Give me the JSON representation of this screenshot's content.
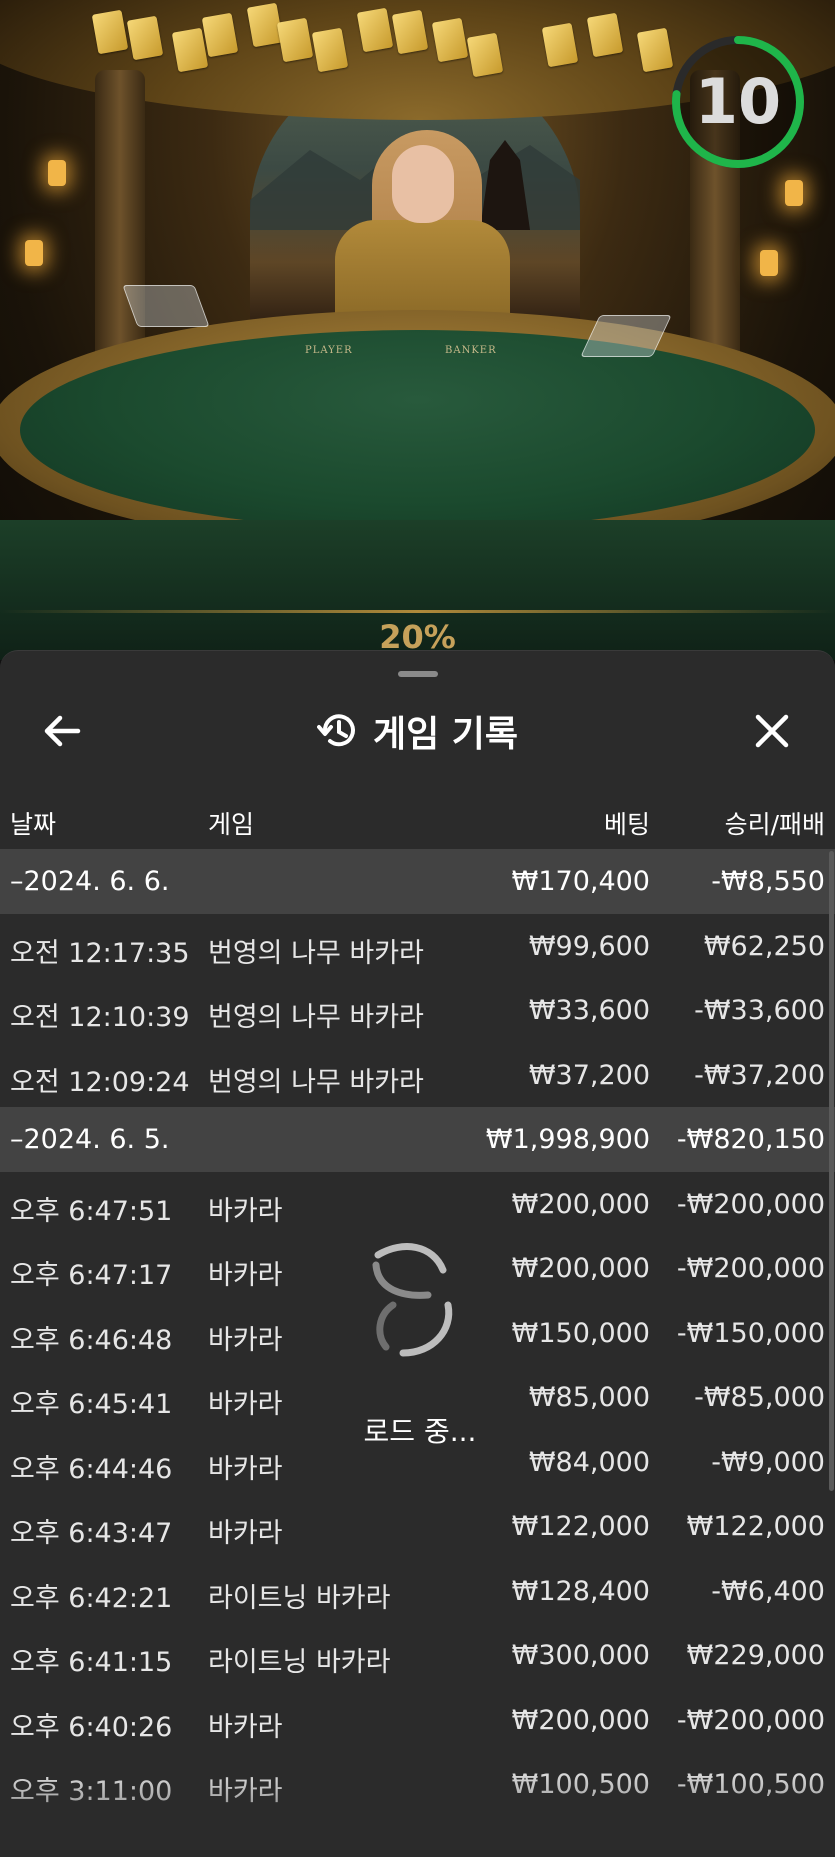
{
  "timer": {
    "value": "10",
    "ring_color": "#1fb54a"
  },
  "table": {
    "player_label": "PLAYER",
    "banker_label": "BANKER",
    "promo": "20%"
  },
  "panel": {
    "title": "게임 기록",
    "icons": {
      "back": "back-arrow-icon",
      "history": "history-icon",
      "close": "close-icon"
    },
    "columns": {
      "date": "날짜",
      "game": "게임",
      "bet": "베팅",
      "result": "승리/패배"
    },
    "rows": [
      {
        "type": "group",
        "date": "–2024. 6. 6.",
        "game": "",
        "bet": "₩170,400",
        "result": "-₩8,550"
      },
      {
        "type": "item",
        "date": "오전 12:17:35",
        "game": "번영의 나무 바카라",
        "bet": "₩99,600",
        "result": "₩62,250"
      },
      {
        "type": "item",
        "date": "오전 12:10:39",
        "game": "번영의 나무 바카라",
        "bet": "₩33,600",
        "result": "-₩33,600"
      },
      {
        "type": "item",
        "date": "오전 12:09:24",
        "game": "번영의 나무 바카라",
        "bet": "₩37,200",
        "result": "-₩37,200"
      },
      {
        "type": "group",
        "date": "–2024. 6. 5.",
        "game": "",
        "bet": "₩1,998,900",
        "result": "-₩820,150"
      },
      {
        "type": "item",
        "date": "오후 6:47:51",
        "game": "바카라",
        "bet": "₩200,000",
        "result": "-₩200,000"
      },
      {
        "type": "item",
        "date": "오후 6:47:17",
        "game": "바카라",
        "bet": "₩200,000",
        "result": "-₩200,000"
      },
      {
        "type": "item",
        "date": "오후 6:46:48",
        "game": "바카라",
        "bet": "₩150,000",
        "result": "-₩150,000"
      },
      {
        "type": "item",
        "date": "오후 6:45:41",
        "game": "바카라",
        "bet": "₩85,000",
        "result": "-₩85,000"
      },
      {
        "type": "item",
        "date": "오후 6:44:46",
        "game": "바카라",
        "bet": "₩84,000",
        "result": "-₩9,000"
      },
      {
        "type": "item",
        "date": "오후 6:43:47",
        "game": "바카라",
        "bet": "₩122,000",
        "result": "₩122,000"
      },
      {
        "type": "item",
        "date": "오후 6:42:21",
        "game": "라이트닝 바카라",
        "bet": "₩128,400",
        "result": "-₩6,400"
      },
      {
        "type": "item",
        "date": "오후 6:41:15",
        "game": "라이트닝 바카라",
        "bet": "₩300,000",
        "result": "₩229,000"
      },
      {
        "type": "item",
        "date": "오후 6:40:26",
        "game": "바카라",
        "bet": "₩200,000",
        "result": "-₩200,000"
      },
      {
        "type": "item",
        "date": "오후 3:11:00",
        "game": "바카라",
        "bet": "₩100,500",
        "result": "-₩100,500"
      }
    ],
    "loading": {
      "text": "로드 중...",
      "icon": "loading-spinner-icon"
    }
  }
}
